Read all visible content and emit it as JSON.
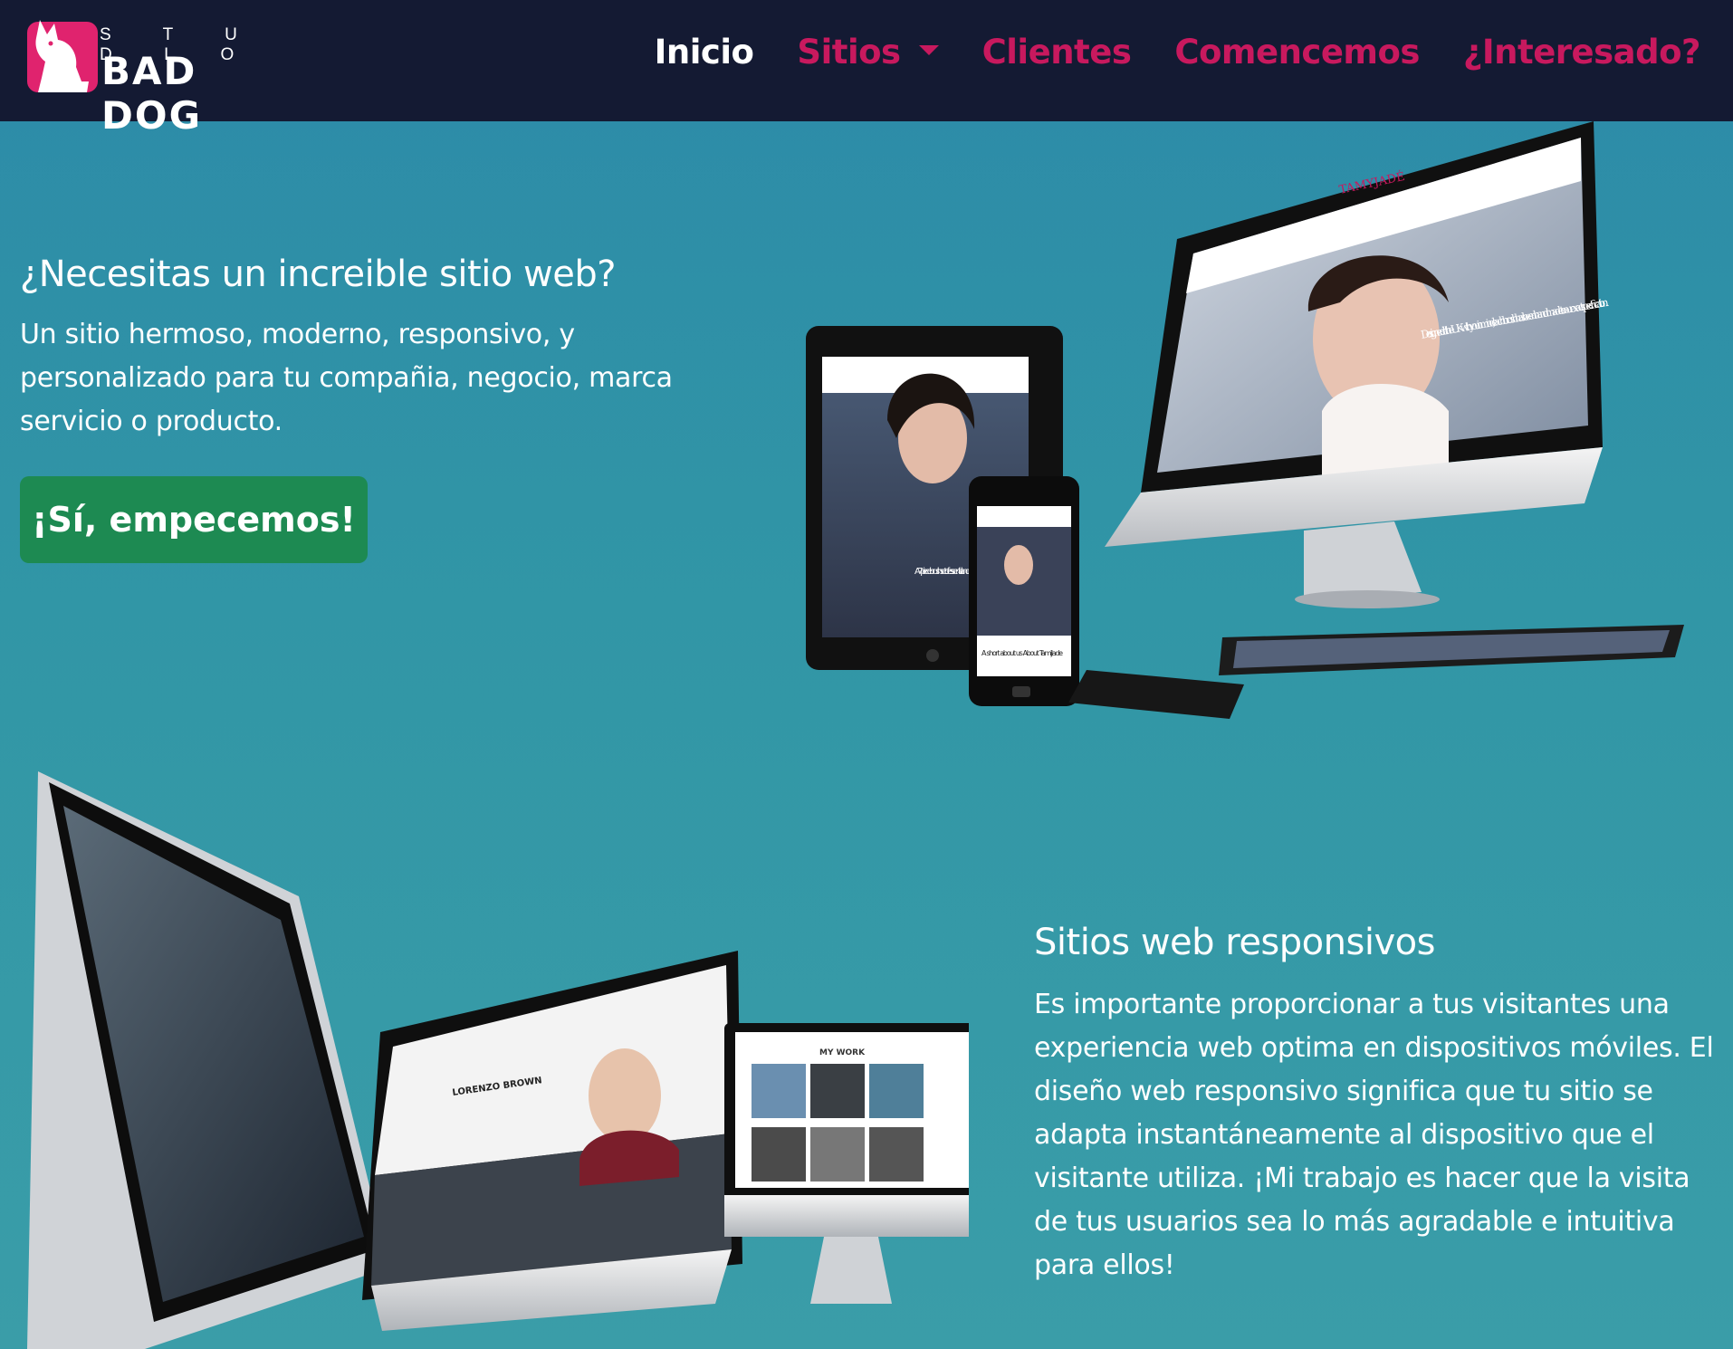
{
  "brand": {
    "top": "S T U D I O",
    "name": "BAD DOG",
    "accent": "#e0236e",
    "nav_bg": "#141a33"
  },
  "nav": {
    "items": [
      {
        "label": "Inicio",
        "active": true
      },
      {
        "label": "Sitios",
        "active": false,
        "dropdown": true
      },
      {
        "label": "Clientes",
        "active": false
      },
      {
        "label": "Comencemos",
        "active": false
      },
      {
        "label": "¿Interesado?",
        "active": false
      }
    ]
  },
  "hero": {
    "title": "¿Necesitas un increible sitio web?",
    "subtitle": "Un sitio hermoso, moderno, responsivo, y personalizado para tu compañia, negocio, marca servicio o producto.",
    "cta": "¡Sí, empecemos!",
    "cta_color": "#1d8a52"
  },
  "devices_top": {
    "brand": "TAMYJADÉ",
    "tagline": "Designed in the UK with you in mind, each brush has been hand made to our exact specification.",
    "tablet_text": "A 7 piece brush set of essential and most brushes girls use everyday.",
    "phone_text": "A short about us About TamiJade"
  },
  "devices_bottom": {
    "card1_title": "LORENZO BROWN",
    "card2_title": "MY WORK"
  },
  "section2": {
    "title": "Sitios web responsivos",
    "body": "Es importante proporcionar a tus visitantes una experiencia web optima en dispositivos móviles. El diseño web responsivo significa que tu sitio se adapta instantáneamente al dispositivo que el visitante utiliza. ¡Mi trabajo es hacer que la visita de tus usuarios sea lo más agradable e intuitiva para ellos!"
  }
}
